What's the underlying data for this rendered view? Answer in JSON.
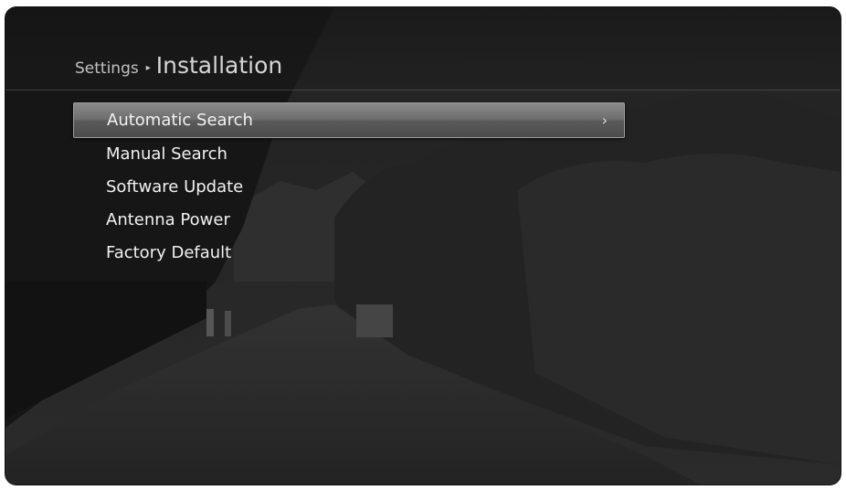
{
  "breadcrumb": {
    "parent": "Settings",
    "separator": "▸",
    "current": "Installation"
  },
  "menu": {
    "selected_index": 0,
    "items": [
      {
        "label": "Automatic Search",
        "has_submenu": true
      },
      {
        "label": "Manual Search",
        "has_submenu": false
      },
      {
        "label": "Software Update",
        "has_submenu": false
      },
      {
        "label": "Antenna Power",
        "has_submenu": false
      },
      {
        "label": "Factory Default",
        "has_submenu": false
      }
    ],
    "chevron": "›"
  },
  "colors": {
    "selection": "#6d6d6d",
    "text": "#f2f2f2",
    "background": "#1e1e1e"
  },
  "icons": {
    "submenu": "chevron-right-icon",
    "separator": "triangle-right-icon"
  }
}
